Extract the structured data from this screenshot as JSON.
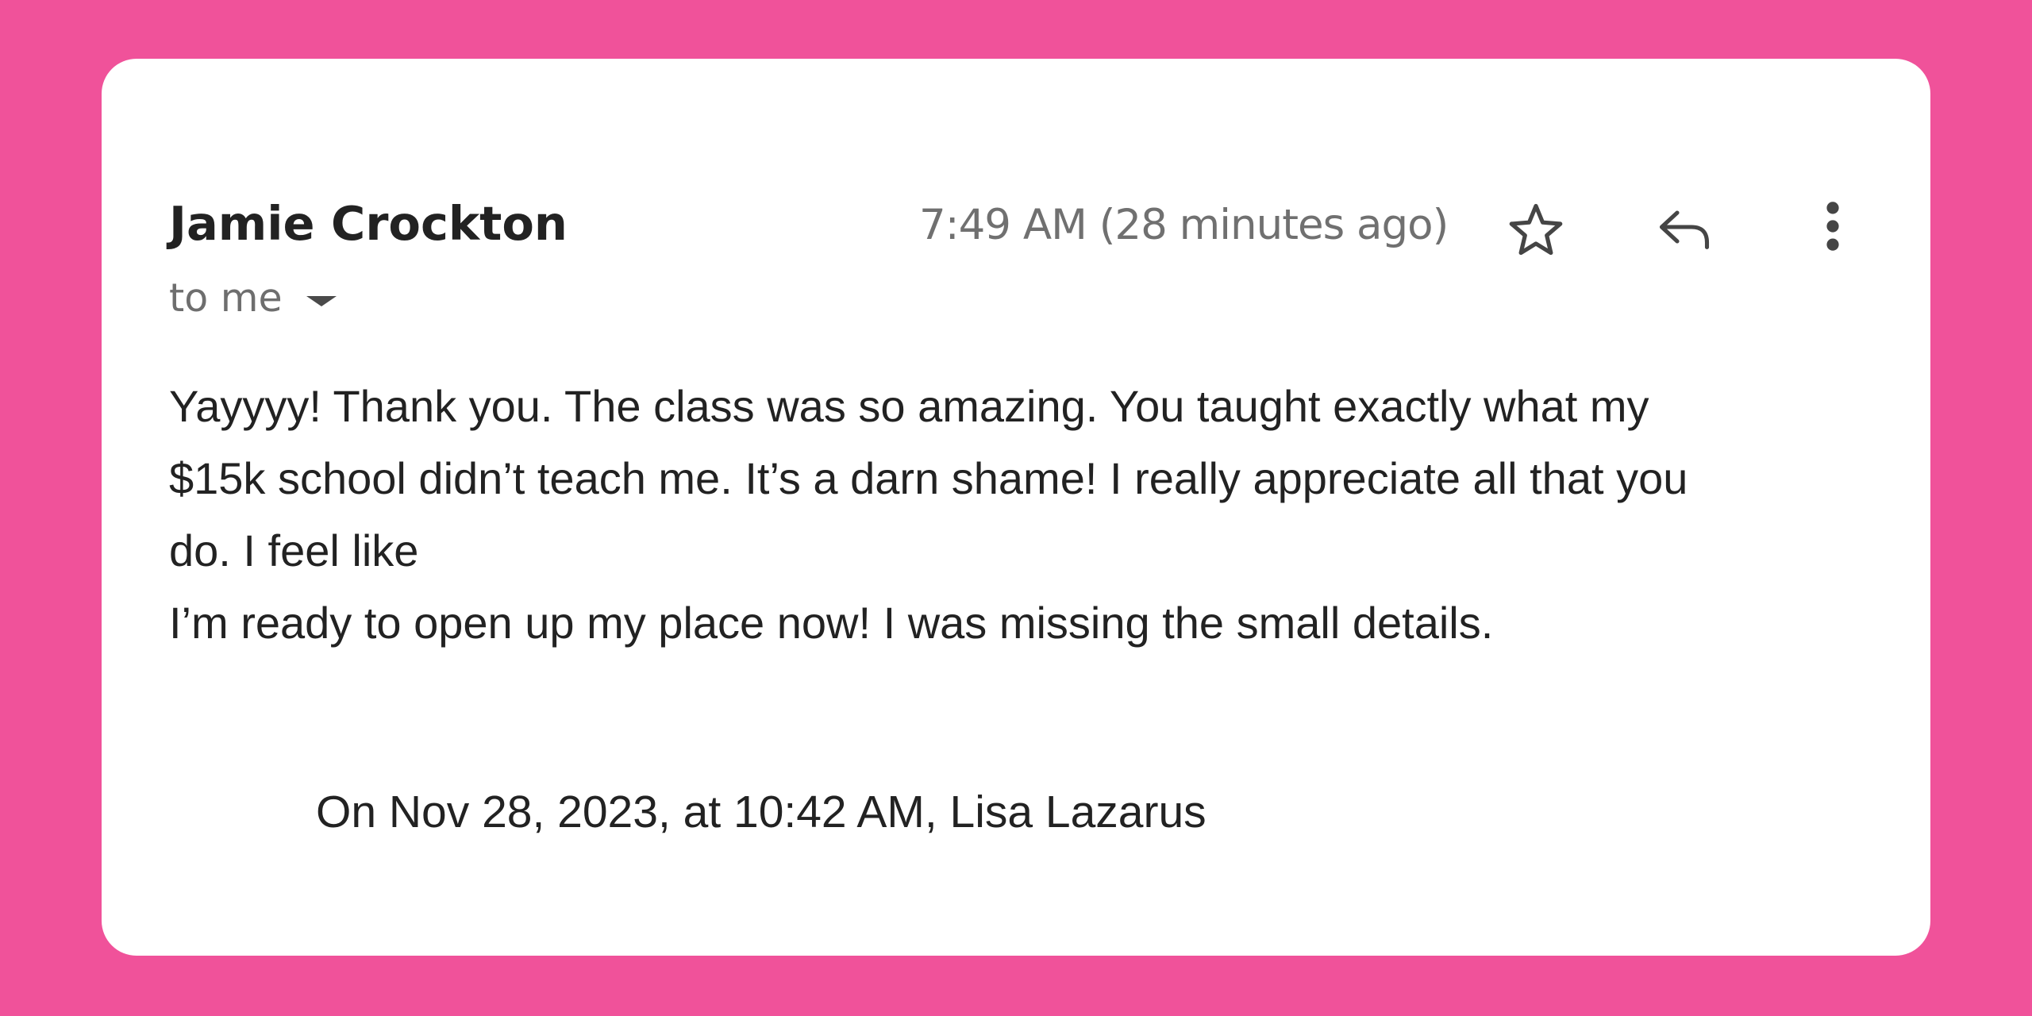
{
  "email": {
    "sender_name": "Jamie Crockton",
    "recipient_label": "to me",
    "timestamp": "7:49 AM (28 minutes ago)",
    "body_lines": [
      "Yayyyy! Thank you. The class was so amazing. You taught exactly what my",
      "$15k school didn’t teach me. It’s a darn shame! I really appreciate all that you",
      "do. I feel like",
      "I’m ready to open up my place now! I was missing the small details."
    ],
    "quoted_header": "On Nov 28, 2023, at 10:42 AM, Lisa Lazarus"
  },
  "icons": {
    "star": "star-icon",
    "reply": "reply-icon",
    "more": "more-vertical-icon",
    "recipient_dropdown": "caret-down-icon"
  },
  "colors": {
    "background": "#F0529A",
    "card": "#FFFFFF",
    "text_primary": "#222222",
    "text_secondary": "#707070"
  }
}
